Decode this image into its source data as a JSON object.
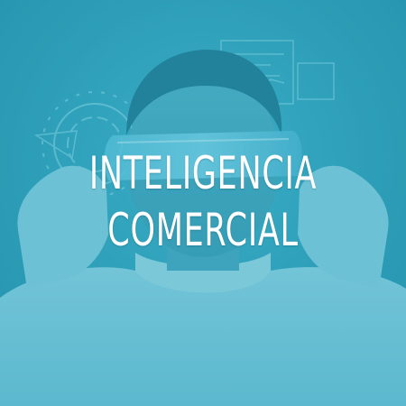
{
  "title": {
    "line1": "INTELIGENCIA",
    "line2": "COMERCIAL"
  },
  "colors": {
    "overlay": "#2b9db7",
    "text": "#ffffff"
  }
}
